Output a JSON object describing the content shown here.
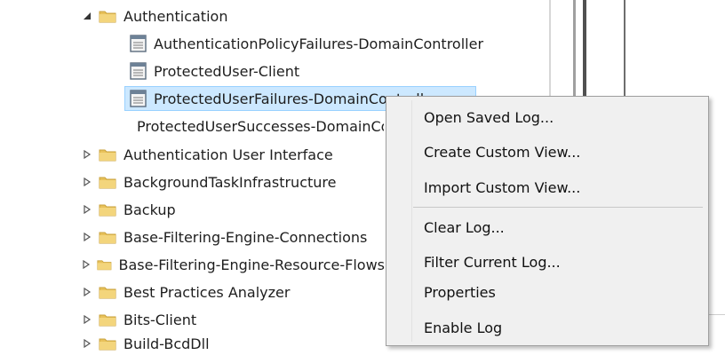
{
  "tree": {
    "items": [
      {
        "label": "Authentication",
        "kind": "folder",
        "expanded": true
      },
      {
        "label": "AuthenticationPolicyFailures-DomainController",
        "kind": "log"
      },
      {
        "label": "ProtectedUser-Client",
        "kind": "log"
      },
      {
        "label": "ProtectedUserFailures-DomainController",
        "kind": "log",
        "selected": true
      },
      {
        "label": "ProtectedUserSuccesses-DomainController",
        "kind": "log"
      },
      {
        "label": "Authentication User Interface",
        "kind": "folder"
      },
      {
        "label": "BackgroundTaskInfrastructure",
        "kind": "folder"
      },
      {
        "label": "Backup",
        "kind": "folder"
      },
      {
        "label": "Base-Filtering-Engine-Connections",
        "kind": "folder"
      },
      {
        "label": "Base-Filtering-Engine-Resource-Flows",
        "kind": "folder"
      },
      {
        "label": "Best Practices Analyzer",
        "kind": "folder"
      },
      {
        "label": "Bits-Client",
        "kind": "folder"
      },
      {
        "label": "Build-BcdDll",
        "kind": "folder"
      }
    ]
  },
  "context_menu": {
    "items": [
      {
        "label": "Open Saved Log..."
      },
      {
        "label": "Create Custom View..."
      },
      {
        "label": "Import Custom View..."
      },
      {
        "label": "Clear Log..."
      },
      {
        "label": "Filter Current Log..."
      },
      {
        "label": "Properties"
      },
      {
        "label": "Enable Log",
        "highlighted": true
      }
    ]
  },
  "colors": {
    "selection": "#cce8ff",
    "highlight": "#f7f727",
    "folder": "#e8c15a"
  }
}
